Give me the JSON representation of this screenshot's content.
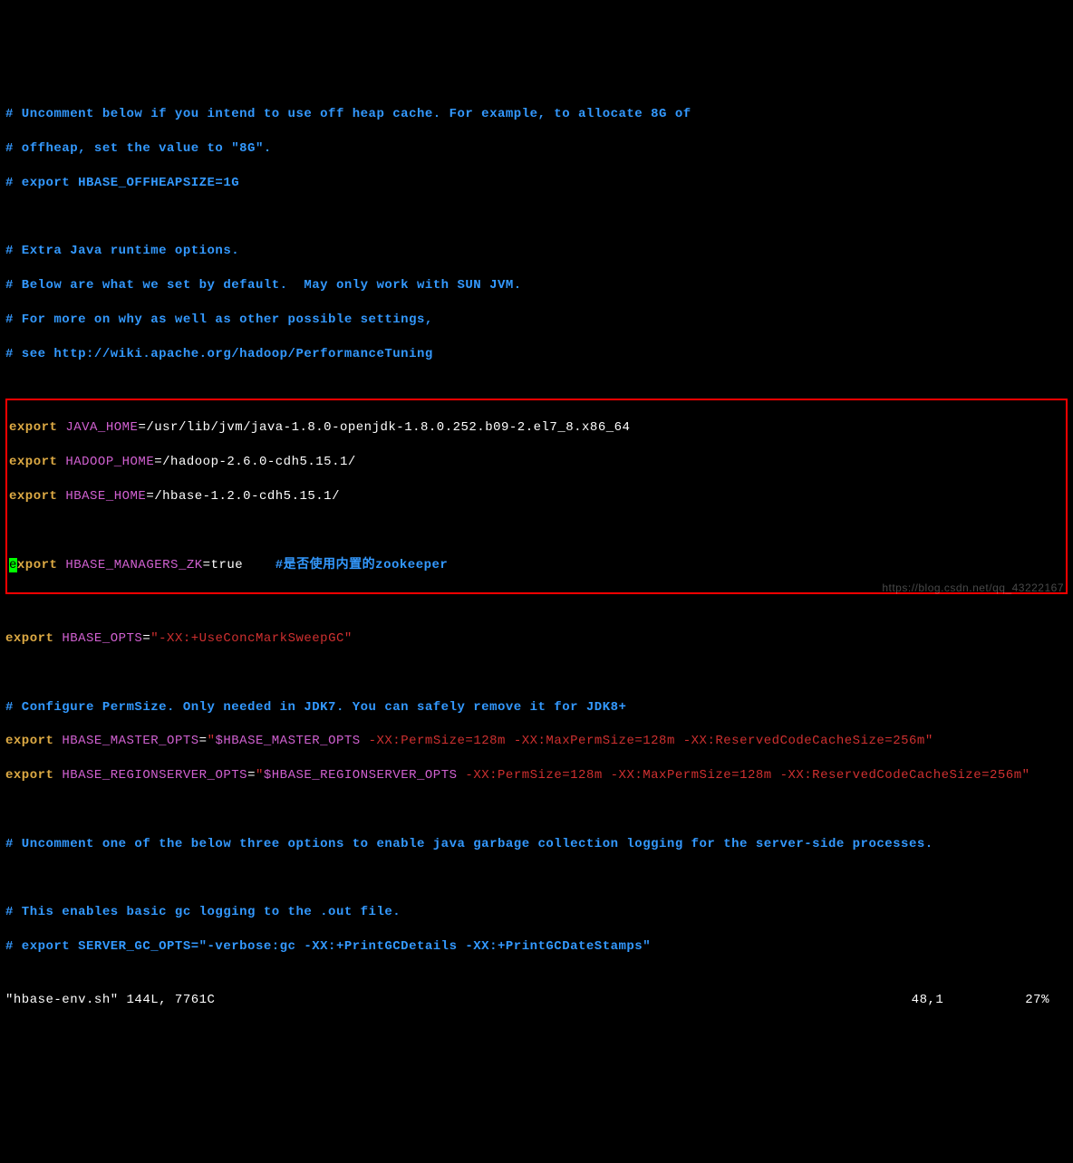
{
  "comments": {
    "c1": "# Uncomment below if you intend to use off heap cache. For example, to allocate 8G of",
    "c2": "# offheap, set the value to \"8G\".",
    "c3": "# export HBASE_OFFHEAPSIZE=1G",
    "c4": "# Extra Java runtime options.",
    "c5": "# Below are what we set by default.  May only work with SUN JVM.",
    "c6": "# For more on why as well as other possible settings,",
    "c7": "# see http://wiki.apache.org/hadoop/PerformanceTuning",
    "c8": "# Configure PermSize. Only needed in JDK7. You can safely remove it for JDK8+",
    "c9": "# Uncomment one of the below three options to enable java garbage collection logging for the server-side processes.",
    "c10": "# This enables basic gc logging to the .out file.",
    "c11": "# export SERVER_GC_OPTS=\"-verbose:gc -XX:+PrintGCDetails -XX:+PrintGCDateStamps\"",
    "zk_comment": "#是否使用内置的zookeeper"
  },
  "exports": {
    "kw": "export",
    "xport_suffix": "xport",
    "eq": "=",
    "q": "\"",
    "java_home_var": " JAVA_HOME",
    "java_home_val": "/usr/lib/jvm/java-1.8.0-openjdk-1.8.0.252.b09-2.el7_8.x86_64",
    "hadoop_home_var": " HADOOP_HOME",
    "hadoop_home_val": "/hadoop-2.6.0-cdh5.15.1/",
    "hbase_home_var": " HBASE_HOME",
    "hbase_home_val": "/hbase-1.2.0-cdh5.15.1/",
    "managers_var": " HBASE_MANAGERS_ZK",
    "managers_val": "true",
    "opts_var": " HBASE_OPTS",
    "opts_str": "-XX:+UseConcMarkSweepGC",
    "master_var": " HBASE_MASTER_OPTS",
    "master_ref": "$HBASE_MASTER_OPTS",
    "master_tail": " -XX:PermSize=128m -XX:MaxPermSize=128m -XX:ReservedCodeCacheSize=256m",
    "region_var": " HBASE_REGIONSERVER_OPTS",
    "region_ref": "$HBASE_REGIONSERVER_OPTS",
    "region_tail": " -XX:PermSize=128m -XX:MaxPermSize=128m -XX:ReservedCodeCacheSize=256m"
  },
  "cursor_char": "e",
  "gap": "    ",
  "status": {
    "file": "\"hbase-env.sh\" 144L, 7761C",
    "pos": "48,1",
    "pct": "27%"
  },
  "watermark": "https://blog.csdn.net/qq_43222167"
}
